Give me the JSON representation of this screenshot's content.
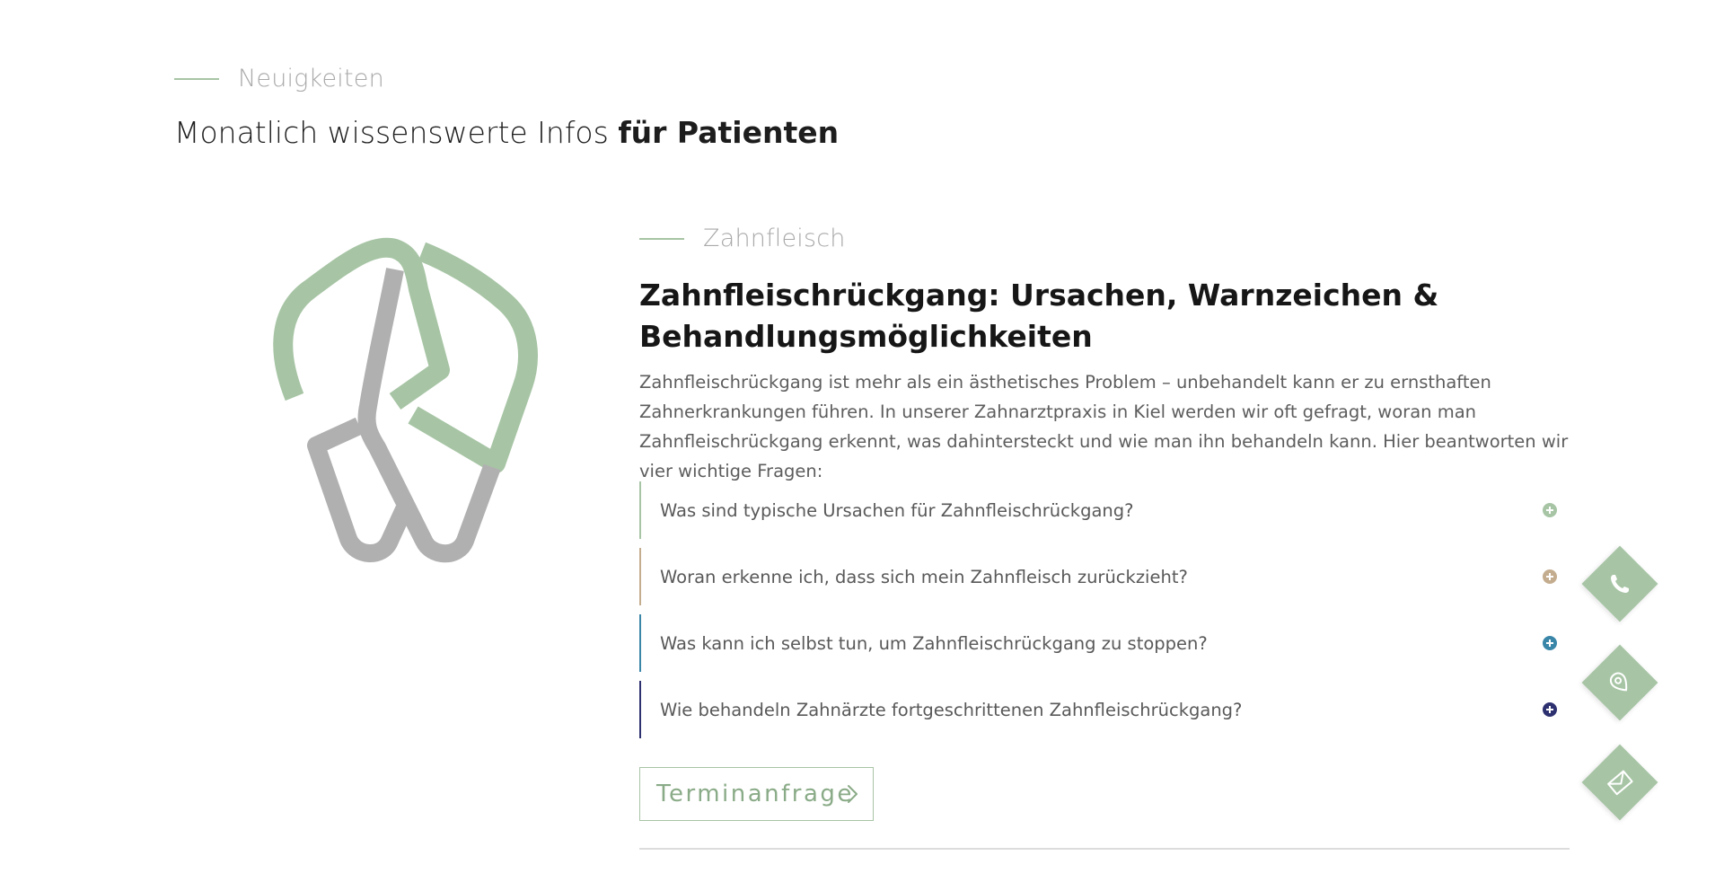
{
  "section": {
    "eyebrow": "Neuigkeiten",
    "title_regular": "Monatlich wissenswerte Infos ",
    "title_bold": "für Patienten"
  },
  "article": {
    "category": "Zahnfleisch",
    "title": "Zahnfleischrückgang: Ursachen, Warnzeichen & Behandlungsmöglichkeiten",
    "intro": "Zahnfleischrückgang ist mehr als ein ästhetisches Problem – unbehandelt kann er zu ernsthaften Zahnerkrankungen führen. In unserer Zahnarztpraxis in Kiel werden wir oft gefragt, woran man Zahnfleischrückgang erkennt, was dahintersteckt und wie man ihn behandeln kann. Hier beantworten wir vier wichtige Fragen:",
    "faq": [
      {
        "question": "Was sind typische Ursachen für Zahnfleischrückgang?",
        "color": "#a7c5a5"
      },
      {
        "question": "Woran erkenne ich, dass sich mein Zahnfleisch zurückzieht?",
        "color": "#c4ad8f"
      },
      {
        "question": "Was kann ich selbst tun, um Zahnfleischrückgang zu stoppen?",
        "color": "#3a86a8"
      },
      {
        "question": "Wie behandeln Zahnärzte fortgeschrittenen Zahnfleischrückgang?",
        "color": "#2e3170"
      }
    ],
    "cta_label": "Terminanfrage",
    "cta_icon": "chevron-right-icon"
  },
  "floating_actions": [
    {
      "name": "phone",
      "icon": "phone-icon"
    },
    {
      "name": "map",
      "icon": "map-pin-icon"
    },
    {
      "name": "mail",
      "icon": "mail-icon"
    }
  ],
  "colors": {
    "accent_green": "#a7c5a5",
    "logo_gray": "#b0b0b0",
    "text_dark": "#161616",
    "text_muted": "#5d5d5d"
  }
}
